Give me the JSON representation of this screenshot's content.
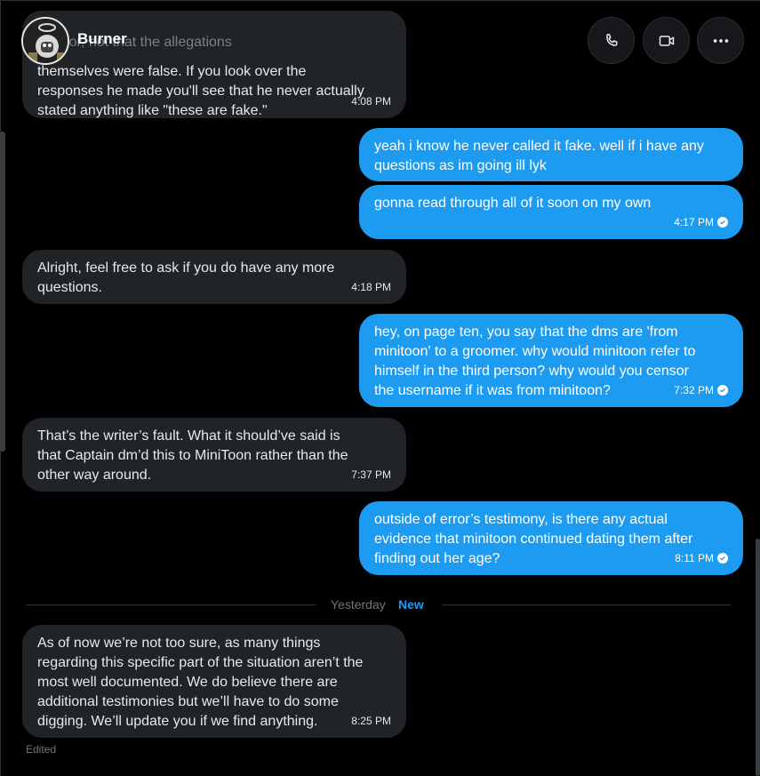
{
  "contact": {
    "name": "Burner"
  },
  "header": {
    "call_icon": "phone-icon",
    "video_icon": "video-camera-icon",
    "more_icon": "more-horizontal-icon"
  },
  "messages": [
    {
      "direction": "in",
      "ghost": "...dator, not that the allegations",
      "lines": [
        "themselves were false. If you look over the",
        "responses he made you'll see that he never actually",
        "stated anything like \"these are fake.\""
      ],
      "time": "4:08 PM"
    },
    {
      "direction": "out",
      "lines": [
        "yeah i know he never called it fake. well if i have any",
        "questions as im going ill lyk"
      ],
      "time": ""
    },
    {
      "direction": "out",
      "lines": [
        "gonna read through all of it soon on my own"
      ],
      "time": "4:17 PM",
      "read": true
    },
    {
      "direction": "in",
      "lines": [
        "Alright, feel free to ask if you do have any more",
        "questions."
      ],
      "time": "4:18 PM"
    },
    {
      "direction": "out",
      "lines": [
        "hey, on page ten, you say that the dms are 'from",
        "minitoon' to a groomer. why would minitoon refer to",
        "himself in the third person? why would you censor",
        "the username if it was from minitoon?"
      ],
      "time": "7:32 PM",
      "read": true
    },
    {
      "direction": "in",
      "lines": [
        "That’s the writer’s fault. What it should’ve said is",
        "that Captain dm’d this to MiniToon rather than the",
        "other way around."
      ],
      "time": "7:37 PM"
    },
    {
      "direction": "out",
      "lines": [
        "outside of error’s testimony, is there any actual",
        "evidence that minitoon continued dating them after",
        "finding out her age?"
      ],
      "time": "8:11 PM",
      "read": true
    },
    {
      "direction": "in",
      "lines": [
        "As of now we’re not too sure, as many things",
        "regarding this specific part of the situation aren’t the",
        "most well documented. We do believe there are",
        "additional testimonies but we’ll have to do some",
        "digging. We’ll update you if we find anything."
      ],
      "time": "8:25 PM"
    }
  ],
  "divider": {
    "label": "Yesterday",
    "badge": "New"
  },
  "footer": {
    "edited_label": "Edited"
  },
  "colors": {
    "outgoing": "#1d9bf0",
    "incoming": "#202327",
    "background": "#000000"
  }
}
